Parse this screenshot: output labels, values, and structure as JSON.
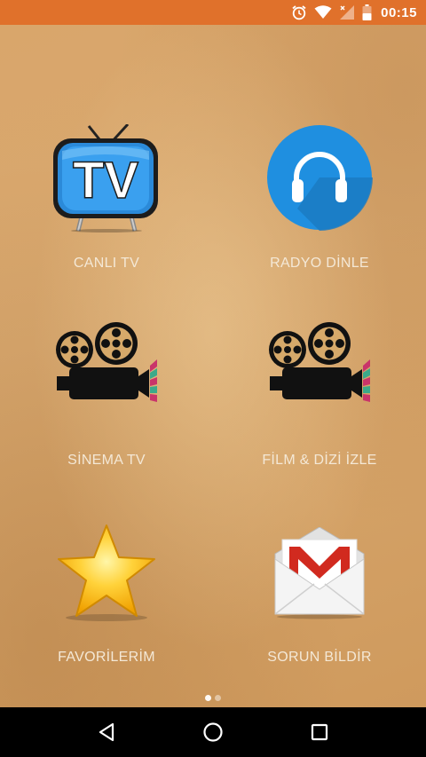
{
  "status_bar": {
    "time": "00:15",
    "icons": [
      "alarm-icon",
      "wifi-icon",
      "cell-signal-off-icon",
      "battery-icon"
    ],
    "background": "#e0712b"
  },
  "menu": {
    "tiles": [
      {
        "label": "CANLI TV",
        "icon": "tv-icon"
      },
      {
        "label": "RADYO DİNLE",
        "icon": "headphones-icon"
      },
      {
        "label": "SİNEMA TV",
        "icon": "film-projector-icon"
      },
      {
        "label": "FİLM & DİZİ İZLE",
        "icon": "film-projector-icon"
      },
      {
        "label": "FAVORİLERİM",
        "icon": "star-icon"
      },
      {
        "label": "SORUN BİLDİR",
        "icon": "mail-icon"
      }
    ],
    "label_color": "#f4e8d6"
  },
  "pager": {
    "pages": 2,
    "active": 1
  },
  "nav_bar": {
    "buttons": [
      "back-icon",
      "home-icon",
      "recents-icon"
    ]
  }
}
